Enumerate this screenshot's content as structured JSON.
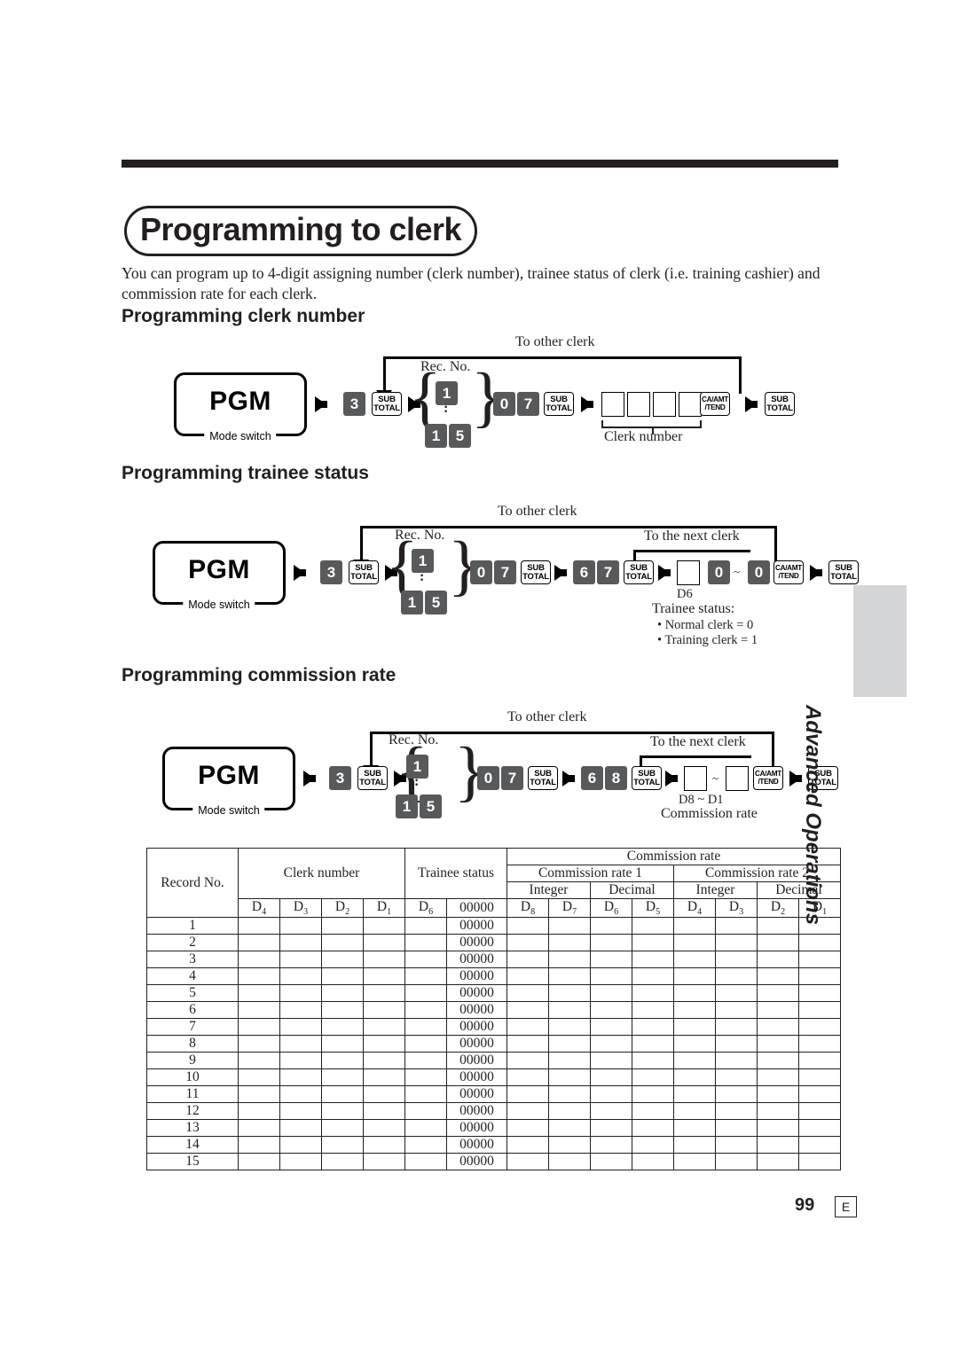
{
  "page": {
    "title": "Programming to clerk",
    "intro": "You can program up to 4-digit assigning number (clerk number), trainee status of clerk (i.e. training cashier) and commission rate for each clerk.",
    "side_tab_text": "Advanced Operations",
    "page_number": "99",
    "page_edition": "E"
  },
  "sections": [
    {
      "heading": "Programming clerk number",
      "mode_switch": {
        "value": "PGM",
        "caption": "Mode switch"
      },
      "loop_label": "To other clerk",
      "rec_no_label": "Rec. No.",
      "rec_no_first": "1",
      "rec_no_dots": ":",
      "rec_no_last_a": "1",
      "rec_no_last_b": "5",
      "keys": {
        "three": "3",
        "subtotal_1": {
          "l1": "SUB",
          "l2": "TOTAL"
        },
        "zero": "0",
        "seven": "7",
        "subtotal_2": {
          "l1": "SUB",
          "l2": "TOTAL"
        },
        "ca_amt": {
          "l1": "CA/AMT",
          "l2": "/TEND"
        },
        "subtotal_3": {
          "l1": "SUB",
          "l2": "TOTAL"
        }
      },
      "entry_caption": "Clerk number"
    },
    {
      "heading": "Programming trainee status",
      "mode_switch": {
        "value": "PGM",
        "caption": "Mode switch"
      },
      "loop_label": "To other clerk",
      "loop2_label": "To the next clerk",
      "rec_no_label": "Rec. No.",
      "rec_no_first": "1",
      "rec_no_dots": ":",
      "rec_no_last_a": "1",
      "rec_no_last_b": "5",
      "keys": {
        "three": "3",
        "subtotal_1": {
          "l1": "SUB",
          "l2": "TOTAL"
        },
        "zero": "0",
        "seven": "7",
        "subtotal_2": {
          "l1": "SUB",
          "l2": "TOTAL"
        },
        "six": "6",
        "seven_b": "7",
        "subtotal_3": {
          "l1": "SUB",
          "l2": "TOTAL"
        },
        "zero_a": "0",
        "tilde": "~",
        "zero_b": "0",
        "ca_amt": {
          "l1": "CA/AMT",
          "l2": "/TEND"
        },
        "subtotal_4": {
          "l1": "SUB",
          "l2": "TOTAL"
        }
      },
      "digit_label": "D6",
      "note_title": "Trainee status:",
      "notes": [
        "• Normal clerk = 0",
        "• Training clerk = 1"
      ]
    },
    {
      "heading": "Programming commission rate",
      "mode_switch": {
        "value": "PGM",
        "caption": "Mode switch"
      },
      "loop_label": "To other clerk",
      "loop2_label": "To the next clerk",
      "rec_no_label": "Rec. No.",
      "rec_no_first": "1",
      "rec_no_dots": ":",
      "rec_no_last_a": "1",
      "rec_no_last_b": "5",
      "keys": {
        "three": "3",
        "subtotal_1": {
          "l1": "SUB",
          "l2": "TOTAL"
        },
        "zero": "0",
        "seven": "7",
        "subtotal_2": {
          "l1": "SUB",
          "l2": "TOTAL"
        },
        "six": "6",
        "eight": "8",
        "subtotal_3": {
          "l1": "SUB",
          "l2": "TOTAL"
        },
        "tilde": "~",
        "ca_amt": {
          "l1": "CA/AMT",
          "l2": "/TEND"
        },
        "subtotal_4": {
          "l1": "SUB",
          "l2": "TOTAL"
        }
      },
      "digit_range": "D8  ~  D1",
      "entry_caption": "Commission rate"
    }
  ],
  "table": {
    "headers": {
      "record_no": "Record No.",
      "clerk_number": "Clerk number",
      "trainee_status": "Trainee status",
      "commission_rate": "Commission rate",
      "commission_rate_1": "Commission rate 1",
      "commission_rate_2": "Commission rate 2",
      "integer": "Integer",
      "decimal": "Decimal"
    },
    "digit_row": {
      "clerk": [
        "D4",
        "D3",
        "D2",
        "D1"
      ],
      "trainee": [
        "D6",
        "00000"
      ],
      "rate1_integer": [
        "D8",
        "D7"
      ],
      "rate1_decimal": [
        "D6",
        "D5"
      ],
      "rate2_integer": [
        "D4",
        "D3"
      ],
      "rate2_decimal": [
        "D2",
        "D1"
      ]
    },
    "rows": [
      {
        "no": "1",
        "zeros": "00000"
      },
      {
        "no": "2",
        "zeros": "00000"
      },
      {
        "no": "3",
        "zeros": "00000"
      },
      {
        "no": "4",
        "zeros": "00000"
      },
      {
        "no": "5",
        "zeros": "00000"
      },
      {
        "no": "6",
        "zeros": "00000"
      },
      {
        "no": "7",
        "zeros": "00000"
      },
      {
        "no": "8",
        "zeros": "00000"
      },
      {
        "no": "9",
        "zeros": "00000"
      },
      {
        "no": "10",
        "zeros": "00000"
      },
      {
        "no": "11",
        "zeros": "00000"
      },
      {
        "no": "12",
        "zeros": "00000"
      },
      {
        "no": "13",
        "zeros": "00000"
      },
      {
        "no": "14",
        "zeros": "00000"
      },
      {
        "no": "15",
        "zeros": "00000"
      }
    ]
  }
}
